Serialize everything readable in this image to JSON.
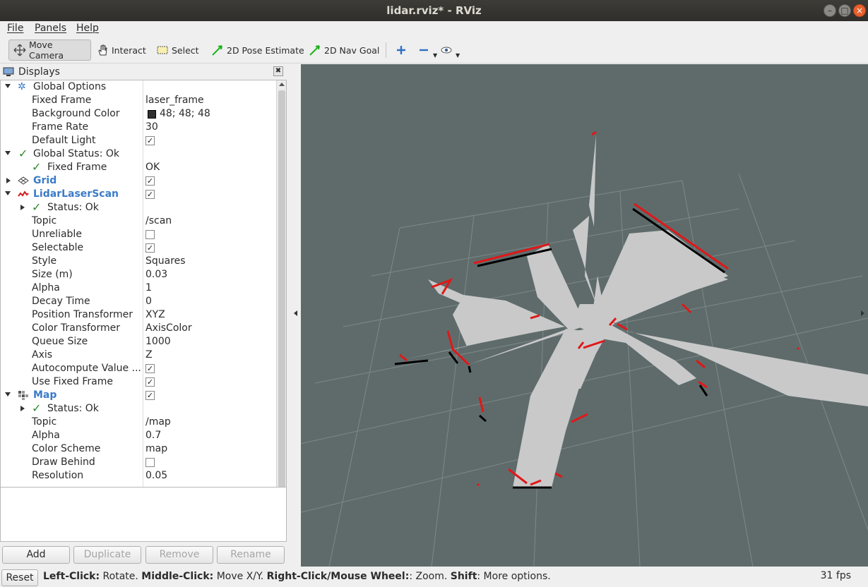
{
  "window": {
    "title": "lidar.rviz* - RViz"
  },
  "menu": {
    "file": "File",
    "panels": "Panels",
    "help": "Help"
  },
  "toolbar": {
    "move_camera": "Move Camera",
    "interact": "Interact",
    "select": "Select",
    "pose_estimate": "2D Pose Estimate",
    "nav_goal": "2D Nav Goal"
  },
  "displays": {
    "title": "Displays",
    "global_options": {
      "label": "Global Options",
      "fixed_frame": {
        "label": "Fixed Frame",
        "value": "laser_frame"
      },
      "background_color": {
        "label": "Background Color",
        "value": "48; 48; 48",
        "swatch": "#303030"
      },
      "frame_rate": {
        "label": "Frame Rate",
        "value": "30"
      },
      "default_light": {
        "label": "Default Light",
        "checked": true
      }
    },
    "global_status": {
      "label": "Global Status: Ok",
      "fixed_frame": {
        "label": "Fixed Frame",
        "value": "OK"
      }
    },
    "grid": {
      "label": "Grid",
      "checked": true
    },
    "lidar": {
      "label": "LidarLaserScan",
      "checked": true,
      "status": "Status: Ok",
      "topic": {
        "label": "Topic",
        "value": "/scan"
      },
      "unreliable": {
        "label": "Unreliable",
        "checked": false
      },
      "selectable": {
        "label": "Selectable",
        "checked": true
      },
      "style": {
        "label": "Style",
        "value": "Squares"
      },
      "size": {
        "label": "Size (m)",
        "value": "0.03"
      },
      "alpha": {
        "label": "Alpha",
        "value": "1"
      },
      "decay_time": {
        "label": "Decay Time",
        "value": "0"
      },
      "position_transformer": {
        "label": "Position Transformer",
        "value": "XYZ"
      },
      "color_transformer": {
        "label": "Color Transformer",
        "value": "AxisColor"
      },
      "queue_size": {
        "label": "Queue Size",
        "value": "1000"
      },
      "axis": {
        "label": "Axis",
        "value": "Z"
      },
      "autocompute": {
        "label": "Autocompute Value ...",
        "checked": true
      },
      "use_fixed_frame": {
        "label": "Use Fixed Frame",
        "checked": true
      }
    },
    "map": {
      "label": "Map",
      "checked": true,
      "status": "Status: Ok",
      "topic": {
        "label": "Topic",
        "value": "/map"
      },
      "alpha": {
        "label": "Alpha",
        "value": "0.7"
      },
      "color_scheme": {
        "label": "Color Scheme",
        "value": "map"
      },
      "draw_behind": {
        "label": "Draw Behind",
        "checked": false
      },
      "resolution": {
        "label": "Resolution",
        "value": "0.05"
      }
    },
    "buttons": {
      "add": "Add",
      "duplicate": "Duplicate",
      "remove": "Remove",
      "rename": "Rename"
    }
  },
  "status": {
    "reset": "Reset",
    "hint_parts": [
      {
        "bold": "Left-Click:",
        "text": " Rotate. "
      },
      {
        "bold": "Middle-Click:",
        "text": " Move X/Y. "
      },
      {
        "bold": "Right-Click/Mouse Wheel:",
        "text": ": Zoom. "
      },
      {
        "bold": "Shift",
        "text": ": More options."
      }
    ],
    "fps": "31 fps"
  },
  "colors": {
    "viewport_bg": "#5f6b6b",
    "map_free": "#c8c8c8",
    "scan_points": "#e01818",
    "link_blue": "#3a7bc8"
  }
}
